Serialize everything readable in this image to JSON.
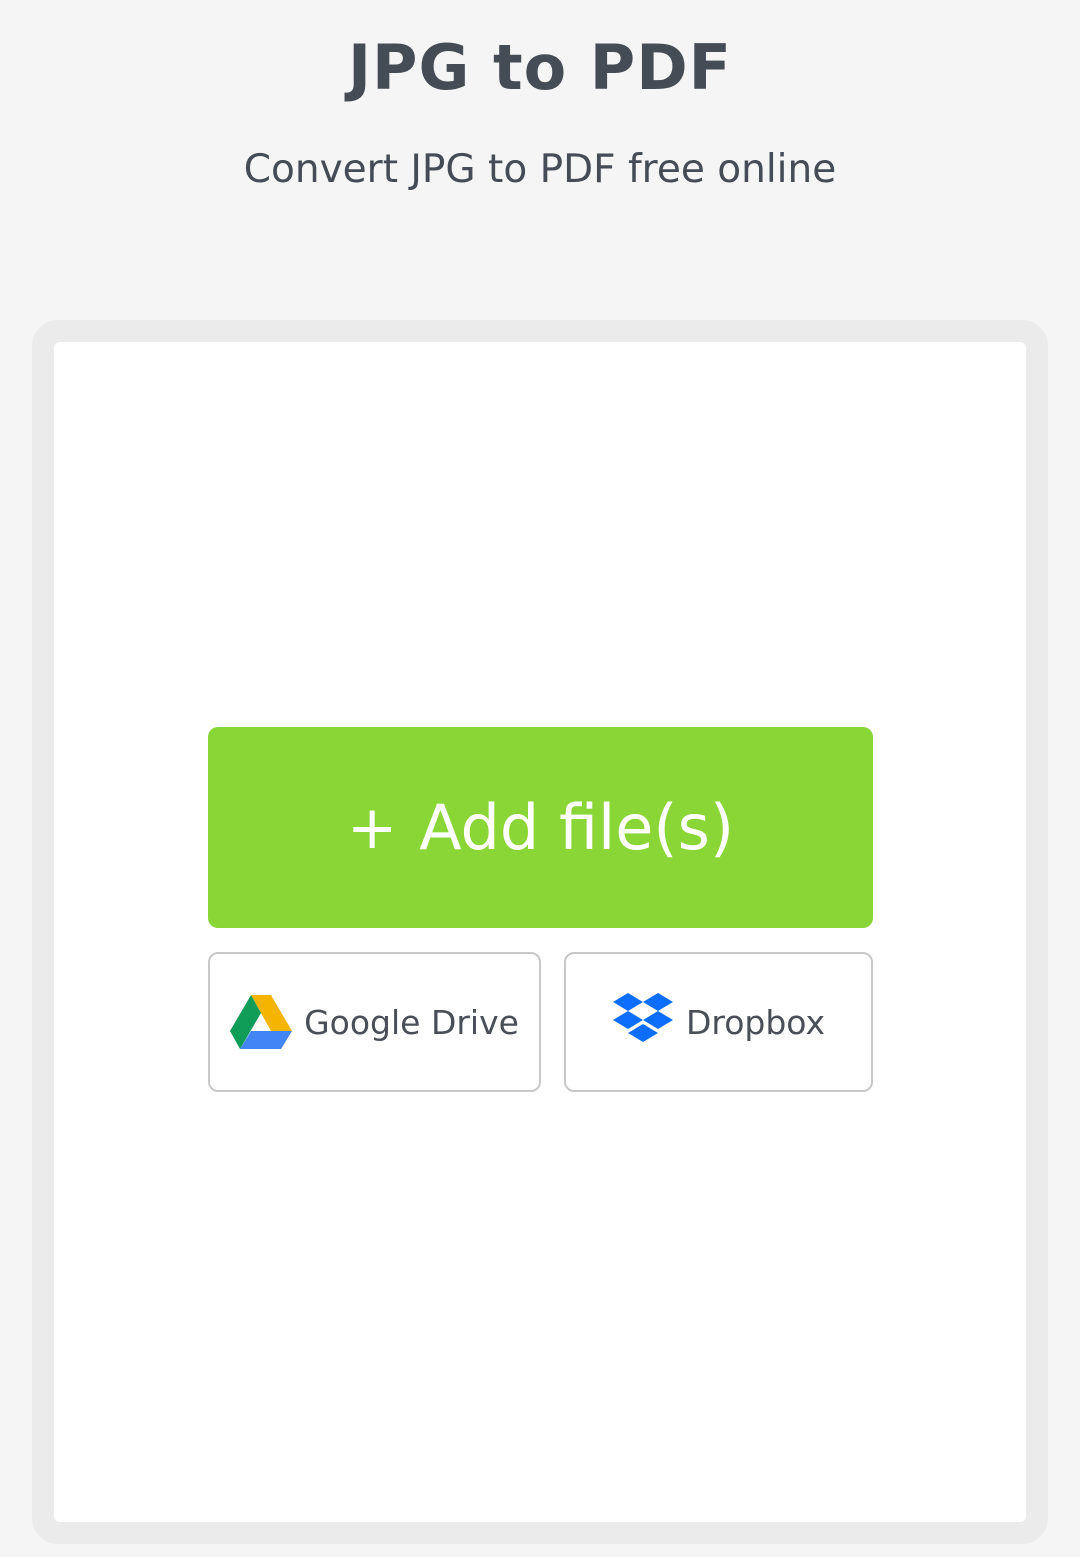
{
  "header": {
    "title": "JPG to PDF",
    "subtitle": "Convert JPG to PDF free online"
  },
  "upload": {
    "add_button": {
      "icon": "plus-icon",
      "icon_glyph": "+",
      "label": "Add file(s)"
    },
    "sources": [
      {
        "label": "Google Drive",
        "icon": "google-drive-icon"
      },
      {
        "label": "Dropbox",
        "icon": "dropbox-icon"
      }
    ]
  },
  "colors": {
    "background": "#f5f5f5",
    "title_text": "#454c55",
    "add_button": "#8ad636",
    "dropbox_blue": "#0d6efd",
    "gdrive_green": "#0f9d58",
    "gdrive_yellow": "#f4b400",
    "gdrive_blue": "#4285f4"
  }
}
